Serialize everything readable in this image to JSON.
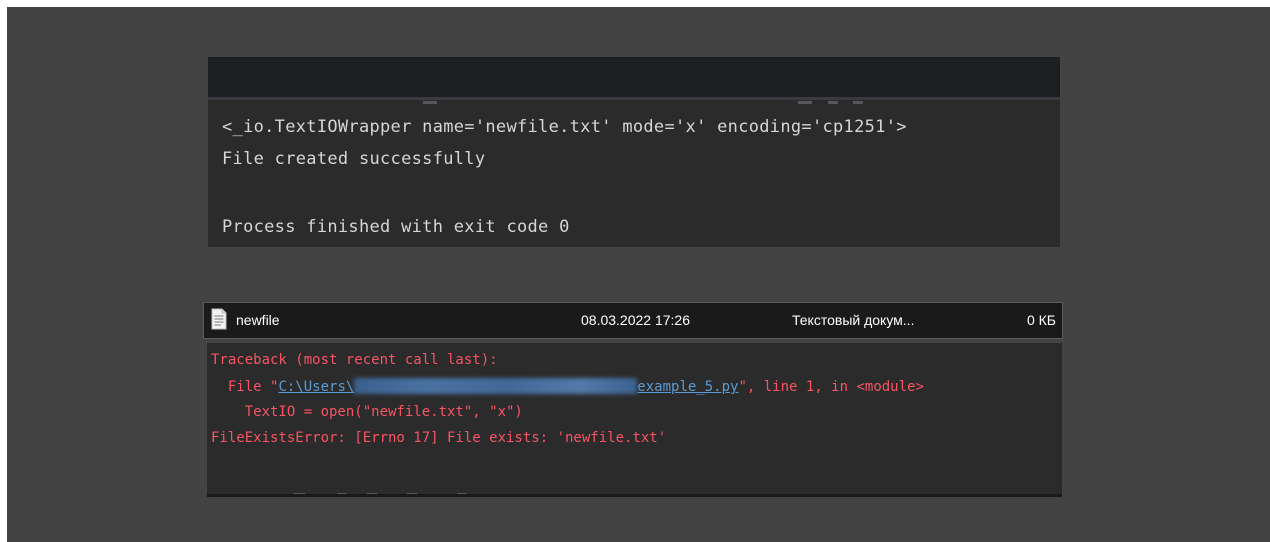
{
  "console_top": {
    "line1": "<_io.TextIOWrapper name='newfile.txt' mode='x' encoding='cp1251'>",
    "line2": "File created successfully",
    "line3": "Process finished with exit code 0"
  },
  "explorer_row": {
    "icon": "text-file-icon",
    "name": "newfile",
    "date": "08.03.2022 17:26",
    "type": "Текстовый докум...",
    "size": "0 КБ"
  },
  "console_bottom": {
    "traceback_header": "Traceback (most recent call last):",
    "file_prefix": "  File \"",
    "path_start": "C:\\Users\\",
    "path_end": "example_5.py",
    "file_suffix": "\", line 1, in <module>",
    "code_line": "    TextIO = open(\"newfile.txt\", \"x\")",
    "error_line": "FileExistsError: [Errno 17] File exists: 'newfile.txt'"
  },
  "colors": {
    "stage_bg": "#434343",
    "console_bg": "#2b2b2b",
    "console_text": "#d4d6d9",
    "error_text": "#f75464",
    "link_text": "#5b9bd5"
  }
}
